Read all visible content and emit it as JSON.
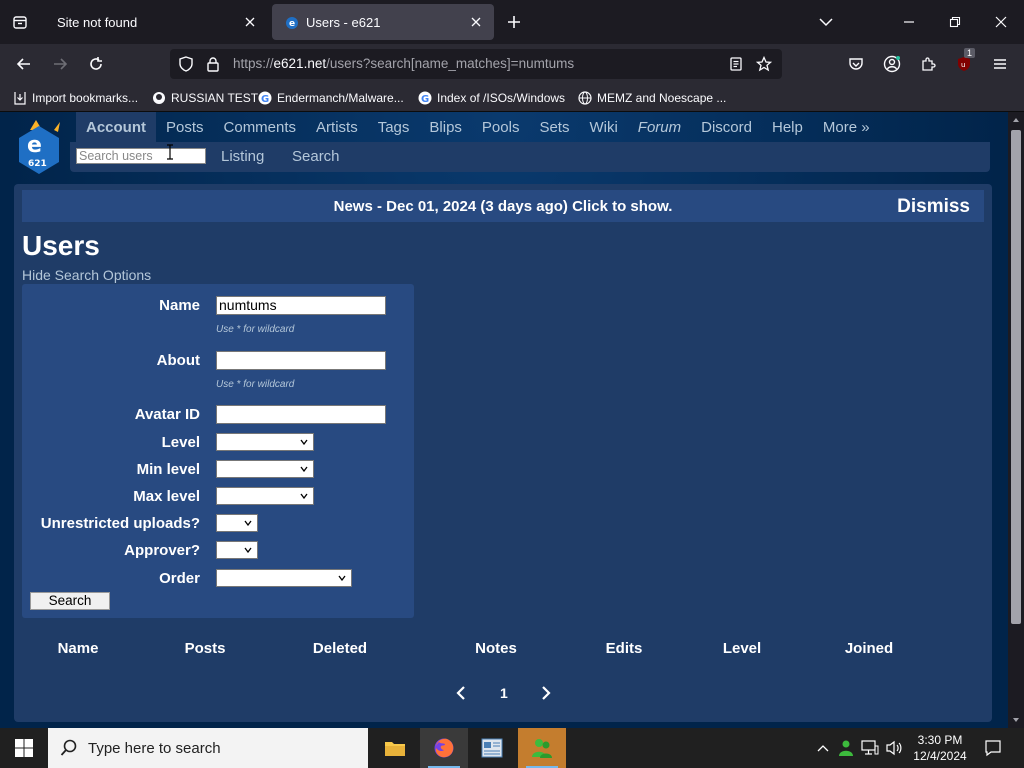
{
  "browser": {
    "tabs": [
      {
        "title": "Site not found"
      },
      {
        "title": "Users - e621"
      }
    ],
    "url_host": "e621.net",
    "url_prefix": "https://",
    "url_path": "/users?search[name_matches]=numtums",
    "bookmarks": [
      {
        "label": "Import bookmarks...",
        "icon": "import-icon"
      },
      {
        "label": "RUSSIAN TEST",
        "icon": "github-icon"
      },
      {
        "label": "Endermanch/Malware...",
        "icon": "google-icon"
      },
      {
        "label": "Index of /ISOs/Windows",
        "icon": "google-icon"
      },
      {
        "label": "MEMZ and Noescape ...",
        "icon": "globe-icon"
      }
    ],
    "badge_count": "1"
  },
  "site": {
    "nav": [
      "Account",
      "Posts",
      "Comments",
      "Artists",
      "Tags",
      "Blips",
      "Pools",
      "Sets",
      "Wiki",
      "Forum",
      "Discord",
      "Help",
      "More »"
    ],
    "search_placeholder": "Search users",
    "subnav": [
      "Listing",
      "Search"
    ],
    "news": "News - Dec 01, 2024 (3 days ago) Click to show.",
    "dismiss": "Dismiss",
    "page_title": "Users",
    "hide_search": "Hide Search Options"
  },
  "form": {
    "name_label": "Name",
    "name_value": "numtums",
    "wildcard_hint": "Use * for wildcard",
    "about_label": "About",
    "avatar_label": "Avatar ID",
    "level_label": "Level",
    "min_level_label": "Min level",
    "max_level_label": "Max level",
    "unrestricted_label": "Unrestricted uploads?",
    "approver_label": "Approver?",
    "order_label": "Order",
    "search_button": "Search"
  },
  "table": {
    "columns": [
      "Name",
      "Posts",
      "Deleted",
      "Notes",
      "Edits",
      "Level",
      "Joined"
    ]
  },
  "pager": {
    "current": "1"
  },
  "taskbar": {
    "search_text": "Type here to search",
    "time": "3:30 PM",
    "date": "12/4/2024"
  }
}
